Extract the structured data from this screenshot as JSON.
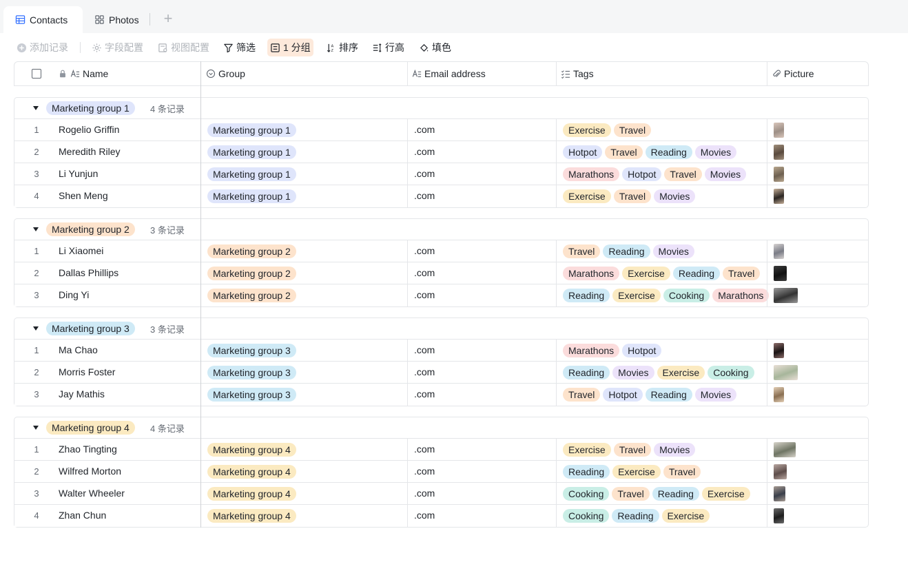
{
  "tabs": [
    {
      "label": "Contacts",
      "icon": "table-icon"
    },
    {
      "label": "Photos",
      "icon": "gallery-icon"
    }
  ],
  "toolbar": {
    "add_record": "添加记录",
    "field_config": "字段配置",
    "view_config": "视图配置",
    "filter": "筛选",
    "group": "1 分组",
    "sort": "排序",
    "row_height": "行高",
    "fill": "填色"
  },
  "columns": {
    "name": "Name",
    "group": "Group",
    "email": "Email address",
    "tags": "Tags",
    "picture": "Picture"
  },
  "colors": {
    "Marketing group 1": "#dfe5fb",
    "Marketing group 2": "#fde3cc",
    "Marketing group 3": "#cfeaf6",
    "Marketing group 4": "#fbeac1",
    "Exercise": "#fbeac1",
    "Travel": "#fde3cc",
    "Reading": "#cfeaf6",
    "Movies": "#ece2fa",
    "Hotpot": "#dfe5fb",
    "Marathons": "#fbdcdc",
    "Cooking": "#c9eee6"
  },
  "groups": [
    {
      "name": "Marketing group 1",
      "count": "4 条记录",
      "rows": [
        {
          "num": "1",
          "name": "Rogelio Griffin",
          "group": "Marketing group 1",
          "email": ".com",
          "tags": [
            "Exercise",
            "Travel"
          ],
          "pic": {
            "c1": "#9d8f86",
            "c2": "#d9c6bb",
            "ratio": 0.7
          }
        },
        {
          "num": "2",
          "name": "Meredith Riley",
          "group": "Marketing group 1",
          "email": ".com",
          "tags": [
            "Hotpot",
            "Travel",
            "Reading",
            "Movies"
          ],
          "pic": {
            "c1": "#5a4a3e",
            "c2": "#a08f7c",
            "ratio": 0.7
          }
        },
        {
          "num": "3",
          "name": "Li Yunjun",
          "group": "Marketing group 1",
          "email": ".com",
          "tags": [
            "Marathons",
            "Hotpot",
            "Travel",
            "Movies"
          ],
          "pic": {
            "c1": "#6d6050",
            "c2": "#b9a78f",
            "ratio": 0.7
          }
        },
        {
          "num": "4",
          "name": "Shen Meng",
          "group": "Marketing group 1",
          "email": ".com",
          "tags": [
            "Exercise",
            "Travel",
            "Movies"
          ],
          "pic": {
            "c1": "#2a2522",
            "c2": "#c7b19a",
            "ratio": 0.7
          }
        }
      ]
    },
    {
      "name": "Marketing group 2",
      "count": "3 条记录",
      "rows": [
        {
          "num": "1",
          "name": "Li Xiaomei",
          "group": "Marketing group 2",
          "email": ".com",
          "tags": [
            "Travel",
            "Reading",
            "Movies"
          ],
          "pic": {
            "c1": "#7a7c86",
            "c2": "#d7d3d2",
            "ratio": 0.7
          }
        },
        {
          "num": "2",
          "name": "Dallas Phillips",
          "group": "Marketing group 2",
          "email": ".com",
          "tags": [
            "Marathons",
            "Exercise",
            "Reading",
            "Travel"
          ],
          "pic": {
            "c1": "#111111",
            "c2": "#3b3b3b",
            "ratio": 0.85
          }
        },
        {
          "num": "3",
          "name": "Ding Yi",
          "group": "Marketing group 2",
          "email": ".com",
          "tags": [
            "Reading",
            "Exercise",
            "Cooking",
            "Marathons"
          ],
          "pic": {
            "c1": "#333333",
            "c2": "#9a9a9a",
            "ratio": 1.6
          }
        }
      ]
    },
    {
      "name": "Marketing group 3",
      "count": "3 条记录",
      "rows": [
        {
          "num": "1",
          "name": "Ma Chao",
          "group": "Marketing group 3",
          "email": ".com",
          "tags": [
            "Marathons",
            "Hotpot"
          ],
          "pic": {
            "c1": "#1a1414",
            "c2": "#8d6d6a",
            "ratio": 0.7
          }
        },
        {
          "num": "2",
          "name": "Morris Foster",
          "group": "Marketing group 3",
          "email": ".com",
          "tags": [
            "Reading",
            "Movies",
            "Exercise",
            "Cooking"
          ],
          "pic": {
            "c1": "#a7b69b",
            "c2": "#e9dfd6",
            "ratio": 1.6
          }
        },
        {
          "num": "3",
          "name": "Jay Mathis",
          "group": "Marketing group 3",
          "email": ".com",
          "tags": [
            "Travel",
            "Hotpot",
            "Reading",
            "Movies"
          ],
          "pic": {
            "c1": "#8a6f52",
            "c2": "#e3cfb6",
            "ratio": 0.7
          }
        }
      ]
    },
    {
      "name": "Marketing group 4",
      "count": "4 条记录",
      "rows": [
        {
          "num": "1",
          "name": "Zhao Tingting",
          "group": "Marketing group 4",
          "email": ".com",
          "tags": [
            "Exercise",
            "Travel",
            "Movies"
          ],
          "pic": {
            "c1": "#6f7564",
            "c2": "#d7d3ca",
            "ratio": 1.45
          }
        },
        {
          "num": "2",
          "name": "Wilfred Morton",
          "group": "Marketing group 4",
          "email": ".com",
          "tags": [
            "Reading",
            "Exercise",
            "Travel"
          ],
          "pic": {
            "c1": "#5d4d4a",
            "c2": "#b9a7a1",
            "ratio": 0.85
          }
        },
        {
          "num": "3",
          "name": "Walter Wheeler",
          "group": "Marketing group 4",
          "email": ".com",
          "tags": [
            "Cooking",
            "Travel",
            "Reading",
            "Exercise"
          ],
          "pic": {
            "c1": "#3a3f4a",
            "c2": "#a79b93",
            "ratio": 0.75
          }
        },
        {
          "num": "4",
          "name": "Zhan Chun",
          "group": "Marketing group 4",
          "email": ".com",
          "tags": [
            "Cooking",
            "Reading",
            "Exercise"
          ],
          "pic": {
            "c1": "#1d1d1d",
            "c2": "#6b6b6b",
            "ratio": 0.7
          }
        }
      ]
    }
  ]
}
